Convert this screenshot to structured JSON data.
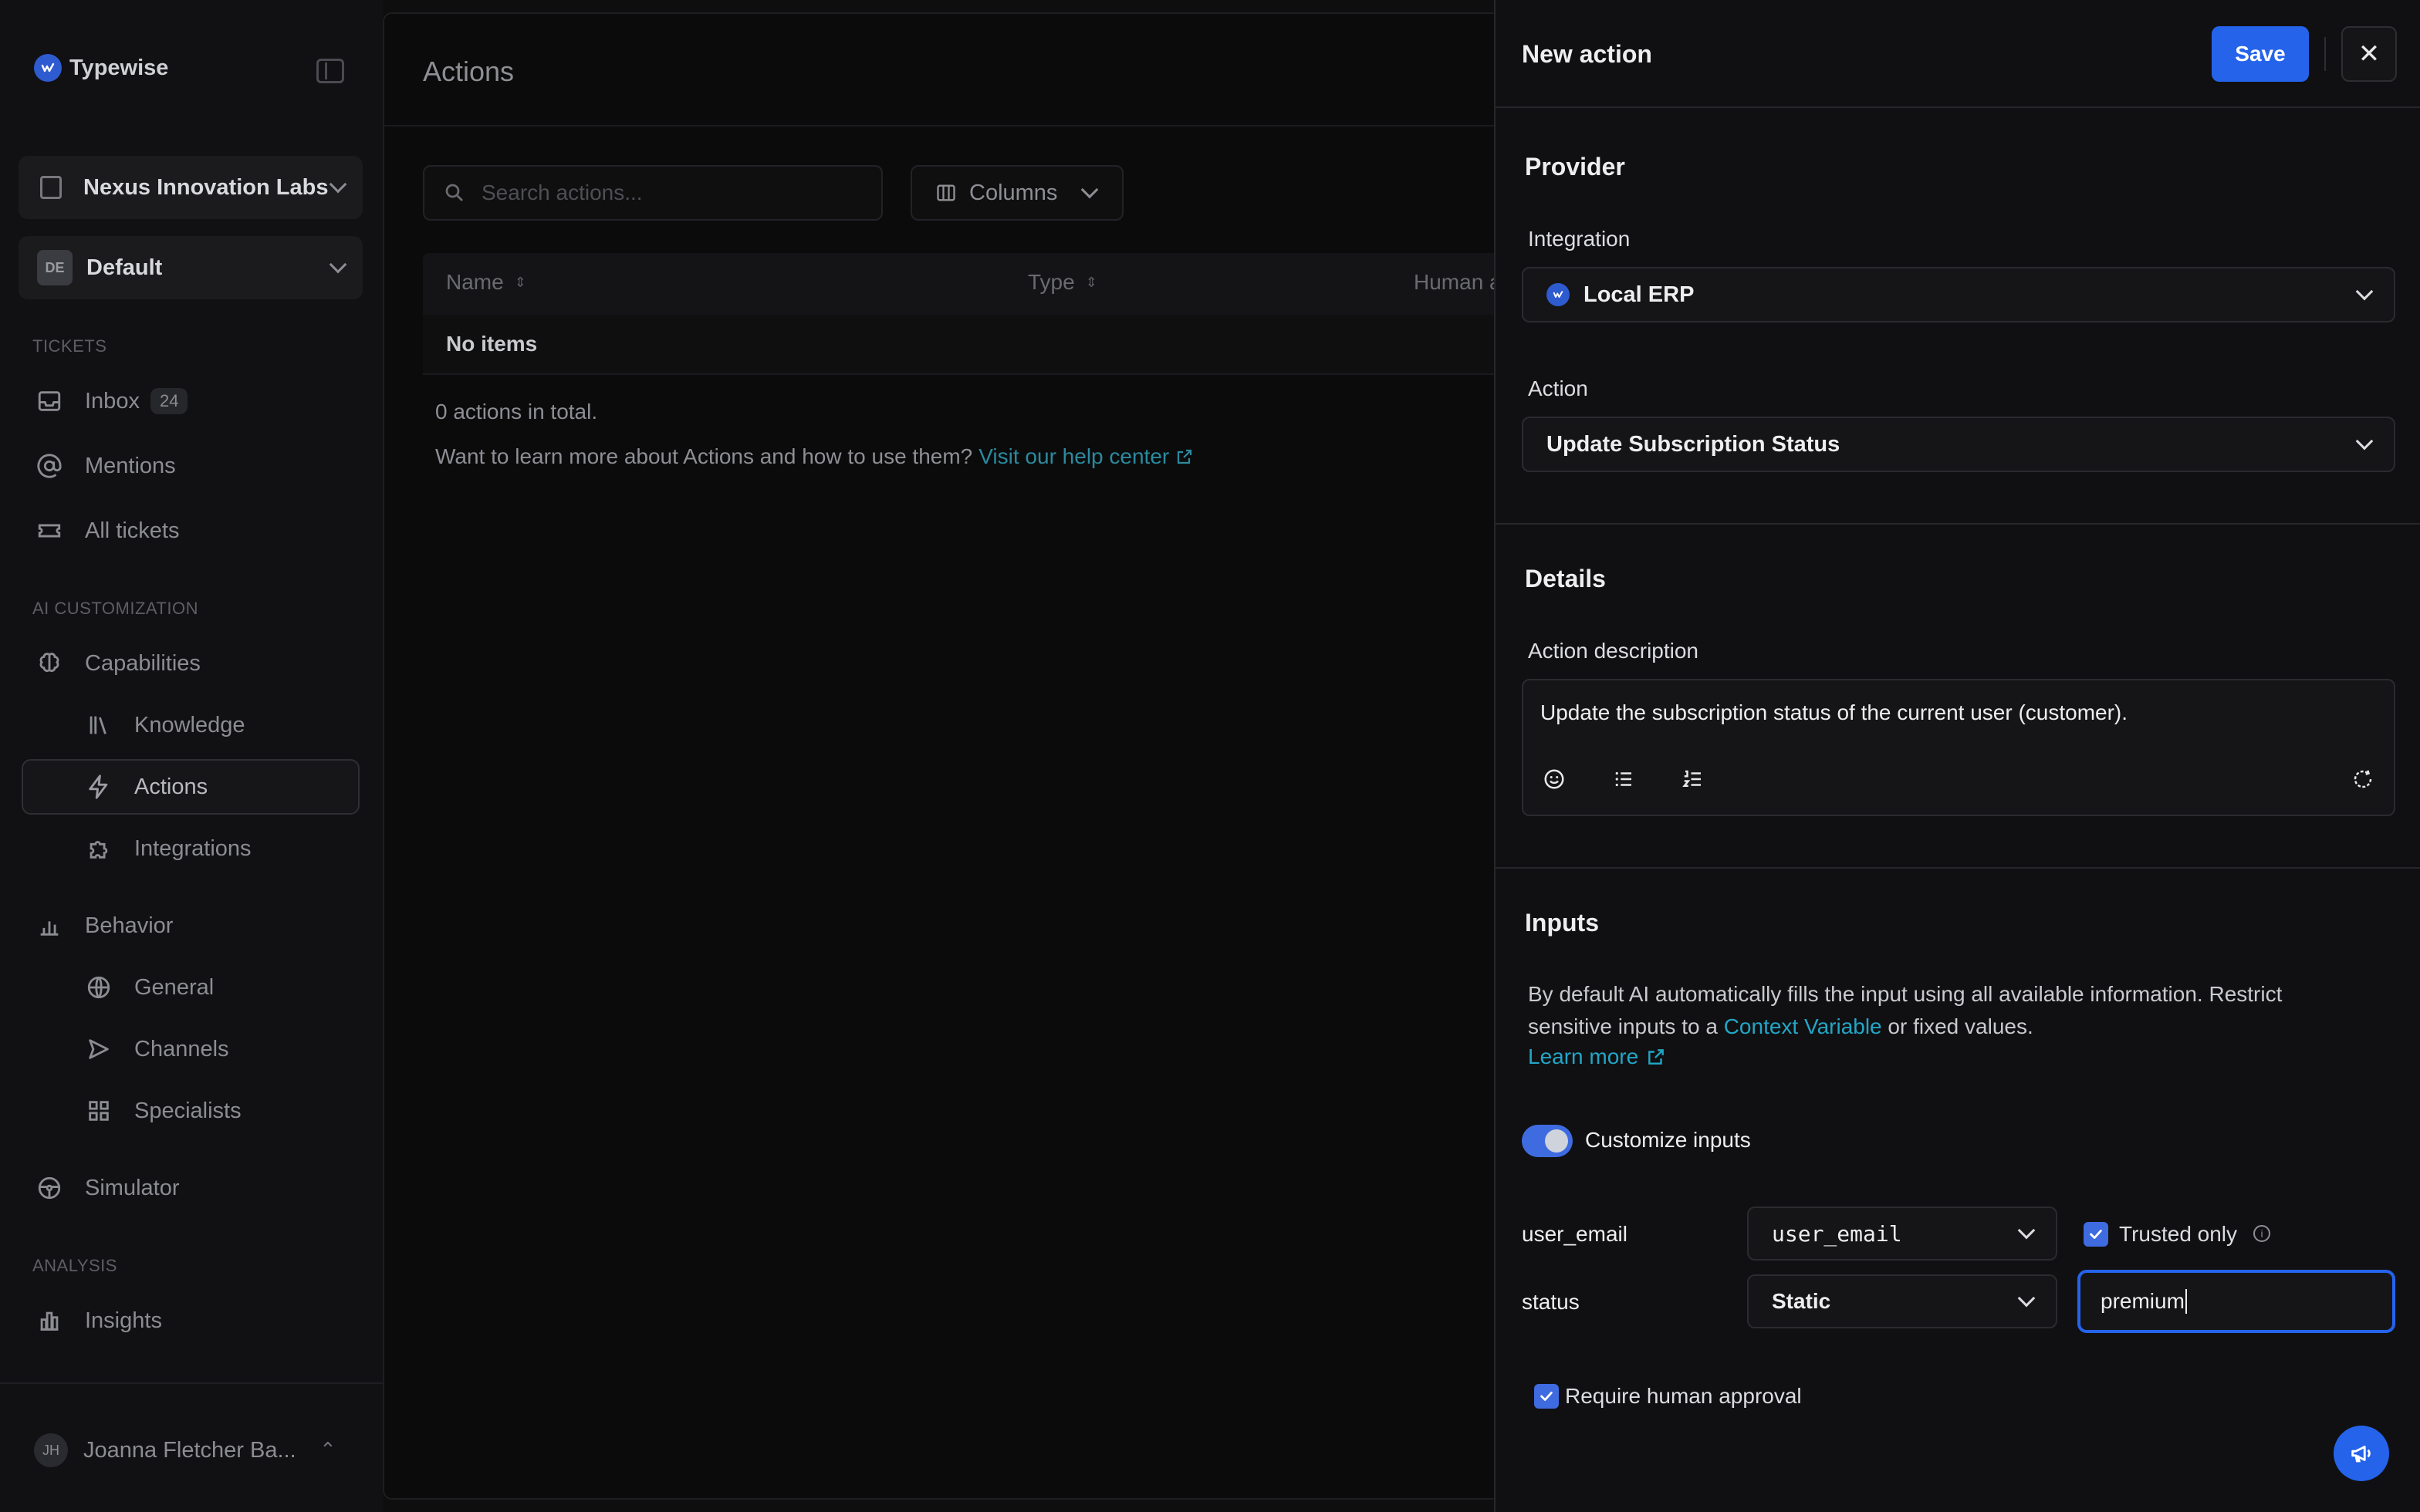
{
  "sidebar": {
    "brand": "Typewise",
    "brand_logo_letter": "tw",
    "organization": "Nexus Innovation Labs",
    "workspace": "Default",
    "workspace_badge": "DE",
    "sections": {
      "tickets": "TICKETS",
      "ai_customization": "AI CUSTOMIZATION",
      "analysis": "ANALYSIS"
    },
    "items": {
      "inbox": "Inbox",
      "inbox_count": "24",
      "mentions": "Mentions",
      "all_tickets": "All tickets",
      "capabilities": "Capabilities",
      "knowledge": "Knowledge",
      "actions": "Actions",
      "integrations": "Integrations",
      "behavior": "Behavior",
      "general": "General",
      "channels": "Channels",
      "specialists": "Specialists",
      "simulator": "Simulator",
      "insights": "Insights"
    },
    "user": {
      "initials": "JH",
      "name": "Joanna Fletcher Ba..."
    }
  },
  "main": {
    "title": "Actions",
    "search_placeholder": "Search actions...",
    "columns_label": "Columns",
    "table": {
      "headers": [
        "Name",
        "Type",
        "Human a"
      ],
      "empty": "No items"
    },
    "total": "0 actions in total.",
    "learn_text": "Want to learn more about Actions and how to use them?",
    "help_link": "Visit our help center"
  },
  "panel": {
    "title": "New action",
    "save_label": "Save",
    "close_glyph": "✕",
    "provider": {
      "title": "Provider",
      "integration_label": "Integration",
      "integration_value": "Local ERP",
      "action_label": "Action",
      "action_value": "Update Subscription Status"
    },
    "details": {
      "title": "Details",
      "description_label": "Action description",
      "description_value": "Update the subscription status of the current user (customer)."
    },
    "inputs": {
      "title": "Inputs",
      "desc_before": "By default AI automatically fills the input using all available information. Restrict sensitive inputs to a ",
      "desc_link": "Context Variable",
      "desc_after": " or fixed values.",
      "learn_more": "Learn more",
      "customize_label": "Customize inputs",
      "customize_on": true,
      "rows": [
        {
          "name": "user_email",
          "source": "user_email",
          "trusted_label": "Trusted only",
          "trusted_checked": true
        },
        {
          "name": "status",
          "source": "Static",
          "value": "premium"
        }
      ],
      "require_approval_label": "Require human approval",
      "require_approval_checked": true
    }
  },
  "colors": {
    "accent": "#2563eb",
    "link": "#22a6c6",
    "toggle": "#3f6be0"
  }
}
